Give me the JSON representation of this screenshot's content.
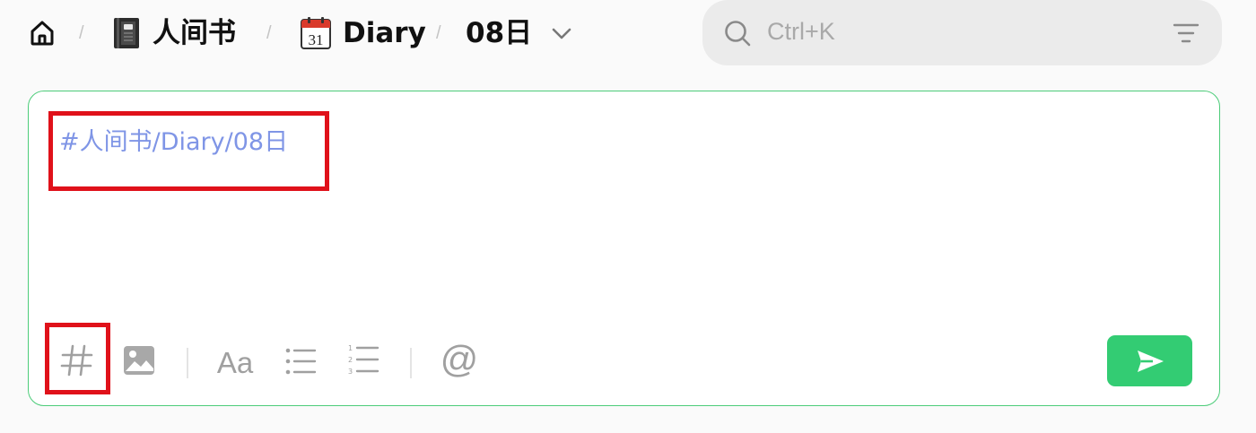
{
  "breadcrumb": {
    "home_icon": "home-icon",
    "separator": "/",
    "items": [
      {
        "label": "人间书",
        "icon": "notebook-icon"
      },
      {
        "label": "Diary",
        "icon": "calendar-icon",
        "icon_text": "31"
      },
      {
        "label": "08日",
        "icon": "chevron-down-icon"
      }
    ]
  },
  "search": {
    "placeholder": "Ctrl+K",
    "icon": "search-icon",
    "filter_icon": "filter-icon"
  },
  "editor": {
    "tag_text": "#人间书/Diary/08日",
    "border_color": "#4ccc79",
    "tag_color": "#7f95e6",
    "highlight_color": "#e0111a",
    "toolbar": {
      "tools": [
        "hash-icon",
        "image-icon",
        "text-format-icon",
        "bullet-list-icon",
        "numbered-list-icon",
        "mention-icon"
      ],
      "text_format_label": "Aa",
      "mention_label": "@"
    },
    "send": {
      "icon": "send-icon",
      "color": "#33cc73"
    }
  }
}
